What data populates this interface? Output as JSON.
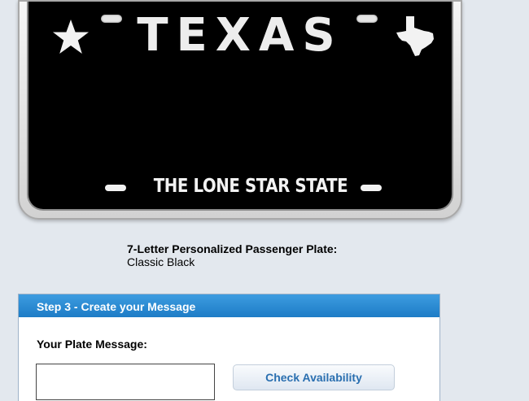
{
  "plate": {
    "state_name": "TEXAS",
    "slogan": "THE LONE STAR STATE",
    "background_color": "#000000",
    "text_color": "#eeeeee",
    "icons": [
      "star-icon",
      "texas-shape-icon"
    ]
  },
  "caption": {
    "plate_type": "7-Letter Personalized Passenger Plate:",
    "plate_style": "Classic Black"
  },
  "step": {
    "header": "Step 3 - Create your Message",
    "message_label": "Your Plate Message:",
    "message_value": "",
    "check_button_label": "Check Availability",
    "header_color": "#2589d4"
  }
}
